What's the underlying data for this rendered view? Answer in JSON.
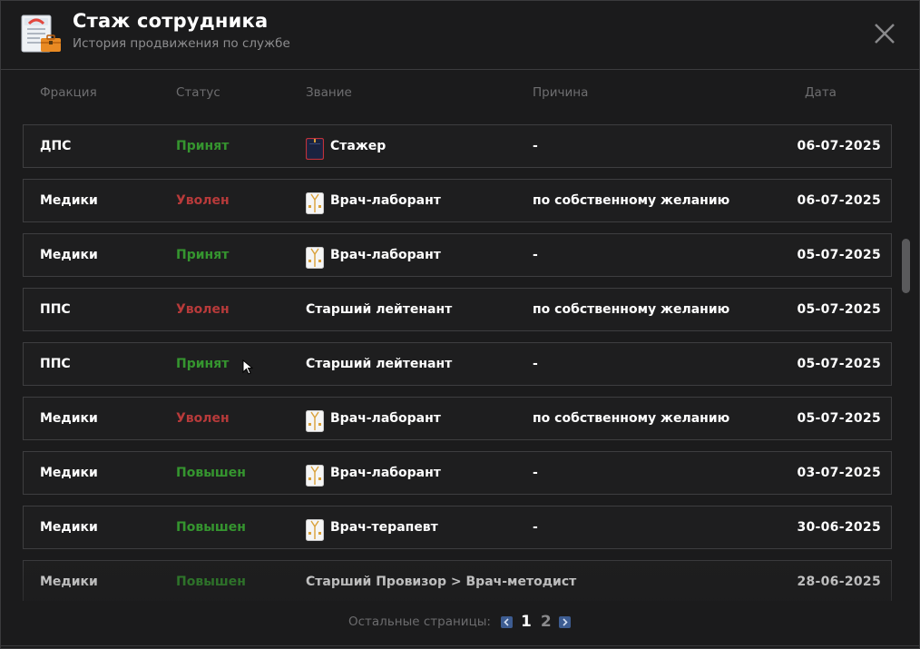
{
  "window": {
    "title": "Стаж сотрудника",
    "subtitle": "История продвижения по службе"
  },
  "columns": {
    "faction": "Фракция",
    "status": "Статус",
    "rank": "Звание",
    "reason": "Причина",
    "date": "Дата"
  },
  "rows": [
    {
      "faction": "ДПС",
      "status": "Принят",
      "status_color": "#35952f",
      "rank": "Стажер",
      "rank_icon": "dps-uniform-icon",
      "reason": "-",
      "date": "06-07-2025"
    },
    {
      "faction": "Медики",
      "status": "Уволен",
      "status_color": "#b73a3a",
      "rank": "Врач-лаборант",
      "rank_icon": "medical-coat-icon",
      "reason": "по собственному желанию",
      "date": "06-07-2025"
    },
    {
      "faction": "Медики",
      "status": "Принят",
      "status_color": "#35952f",
      "rank": "Врач-лаборант",
      "rank_icon": "medical-coat-icon",
      "reason": "-",
      "date": "05-07-2025"
    },
    {
      "faction": "ППС",
      "status": "Уволен",
      "status_color": "#b73a3a",
      "rank": "Старший лейтенант",
      "rank_icon": "",
      "reason": "по собственному желанию",
      "date": "05-07-2025"
    },
    {
      "faction": "ППС",
      "status": "Принят",
      "status_color": "#35952f",
      "rank": "Старший лейтенант",
      "rank_icon": "",
      "reason": "-",
      "date": "05-07-2025"
    },
    {
      "faction": "Медики",
      "status": "Уволен",
      "status_color": "#b73a3a",
      "rank": "Врач-лаборант",
      "rank_icon": "medical-coat-icon",
      "reason": "по собственному желанию",
      "date": "05-07-2025"
    },
    {
      "faction": "Медики",
      "status": "Повышен",
      "status_color": "#35952f",
      "rank": "Врач-лаборант",
      "rank_icon": "medical-coat-icon",
      "reason": "-",
      "date": "03-07-2025"
    },
    {
      "faction": "Медики",
      "status": "Повышен",
      "status_color": "#35952f",
      "rank": "Врач-терапевт",
      "rank_icon": "medical-coat-icon",
      "reason": "-",
      "date": "30-06-2025"
    },
    {
      "faction": "Медики",
      "status": "Повышен",
      "status_color": "#35952f",
      "rank": "Старший Провизор > Врач-методист",
      "rank_icon": "",
      "reason": "",
      "date": "28-06-2025"
    }
  ],
  "pagination": {
    "label": "Остальные страницы:",
    "pages": [
      "1",
      "2"
    ],
    "current": "1",
    "accent": "#3d5c91"
  }
}
